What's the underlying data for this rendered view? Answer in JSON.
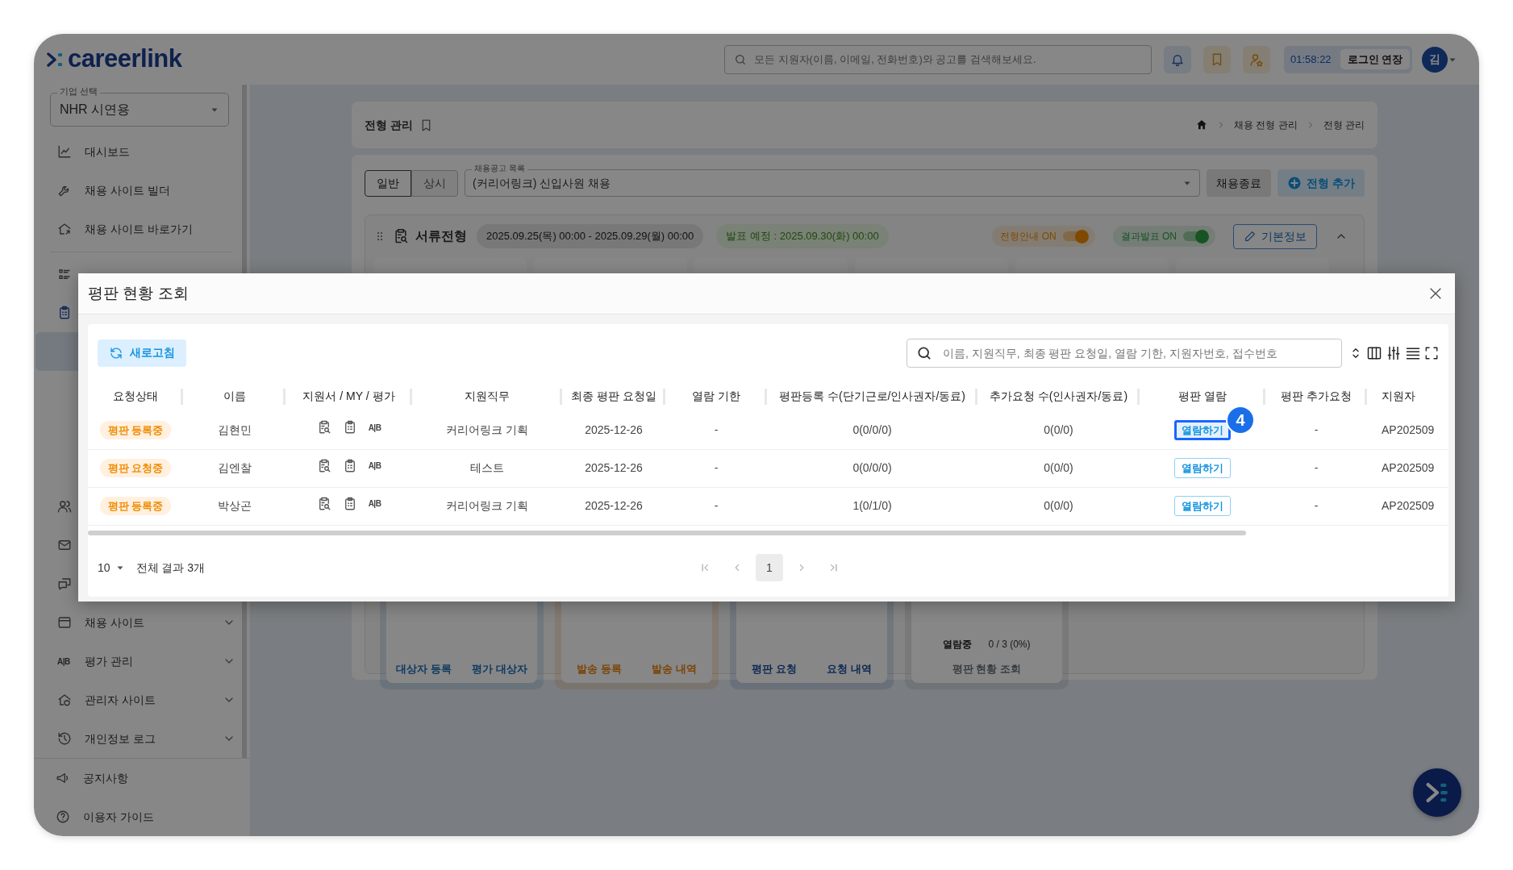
{
  "topbar": {
    "logo": "careerlink",
    "search": {
      "placeholder": "모든 지원자(이름, 이메일, 전화번호)와 공고를 검색해보세요."
    },
    "timer": "01:58:22",
    "extend_button": "로그인 연장",
    "avatar": "김"
  },
  "sidebar": {
    "company_select": {
      "label": "기업 선택",
      "value": "NHR 시연용"
    },
    "groups": [
      [
        {
          "label": "대시보드",
          "active": false
        },
        {
          "label": "채용 사이트 빌더",
          "active": false
        },
        {
          "label": "채용 사이트 바로가기",
          "active": false
        }
      ],
      [
        {
          "active": false
        },
        {
          "active": true,
          "children": [
            {
              "selected": true
            }
          ]
        },
        {
          "active": false
        },
        {
          "active": false
        },
        {
          "active": false
        },
        {
          "label": "채용 사이트",
          "active": false,
          "expanded": false
        },
        {
          "label": "평가 관리",
          "icon_text": "A|B",
          "active": false,
          "expanded": false
        },
        {
          "label": "관리자 사이트",
          "active": false,
          "expanded": false
        },
        {
          "label": "개인정보 로그",
          "active": false,
          "expanded": false
        }
      ]
    ],
    "footer_items": [
      {
        "label": "공지사항"
      },
      {
        "label": "이용자 가이드"
      }
    ]
  },
  "page_header": {
    "title": "전형 관리",
    "breadcrumb": [
      "채용 전형 관리",
      "전형 관리"
    ]
  },
  "filters": {
    "modes": [
      {
        "label": "일반",
        "selected": true
      },
      {
        "label": "상시",
        "selected": false
      }
    ],
    "posting_select": {
      "label": "채용공고 목록",
      "value": "(커리어링크) 신입사원 채용"
    },
    "buttons": [
      {
        "label": "채용종료",
        "kind": "secondary"
      },
      {
        "label": "전형 추가",
        "kind": "add"
      }
    ]
  },
  "stage": {
    "title": "서류전형",
    "period": "2025.09.25(목) 00:00 - 2025.09.29(월) 00:00",
    "announcement": "발표 예정 : 2025.09.30(화) 00:00",
    "toggles": [
      {
        "label": "전형안내 ON",
        "on": true
      },
      {
        "label": "결과발표 ON",
        "on": true
      }
    ],
    "info_button": "기본정보",
    "expanded": true,
    "groups": [
      {
        "links": [
          "대상자 등록",
          "평가 대상자"
        ]
      },
      {
        "links": [
          "발송 등록",
          "발송 내역"
        ]
      },
      {
        "links": [
          "평판 요청",
          "요청 내역"
        ]
      },
      {
        "stat": {
          "label": "열람중",
          "value": "0 / 3 (0%)"
        },
        "links": [
          "평판 현황 조회"
        ]
      }
    ]
  },
  "modal": {
    "title": "평판 현황 조회",
    "refresh_button": "새로고침",
    "search": {
      "placeholder": "이름, 지원직무, 최종 평판 요청일, 열람 기한, 지원자번호, 접수번호"
    },
    "table": {
      "columns": [
        "요청상태",
        "이름",
        "지원서 / MY / 평가",
        "지원직무",
        "최종 평판 요청일",
        "열람 기한",
        "평판등록 수(단기근로/인사권자/동료)",
        "추가요청 수(인사권자/동료)",
        "평판 열람",
        "평판 추가요청",
        "지원자"
      ],
      "rows": [
        {
          "status": "평판 등록중",
          "name": "김현민",
          "eval": "A|B",
          "job": "커리어링크 기획",
          "last_request": "2025-12-26",
          "deadline": "-",
          "registered": "0(0/0/0)",
          "extra_count": "0(0/0)",
          "view_button": {
            "label": "열람하기",
            "highlighted": true,
            "callout": "4"
          },
          "extra_request": "-",
          "applicant_no": "AP202509"
        },
        {
          "status": "평판 요청중",
          "name": "김엔찰",
          "eval": "A|B",
          "job": "테스트",
          "last_request": "2025-12-26",
          "deadline": "-",
          "registered": "0(0/0/0)",
          "extra_count": "0(0/0)",
          "view_button": {
            "label": "열람하기",
            "highlighted": false
          },
          "extra_request": "-",
          "applicant_no": "AP202509"
        },
        {
          "status": "평판 등록중",
          "name": "박상곤",
          "eval": "A|B",
          "job": "커리어링크 기획",
          "last_request": "2025-12-26",
          "deadline": "-",
          "registered": "1(0/1/0)",
          "extra_count": "0(0/0)",
          "view_button": {
            "label": "열람하기",
            "highlighted": false
          },
          "extra_request": "-",
          "applicant_no": "AP202509"
        }
      ]
    },
    "page_size": "10",
    "total": "전체 결과 3개",
    "pages": [
      {
        "label": "1",
        "selected": true
      }
    ]
  }
}
